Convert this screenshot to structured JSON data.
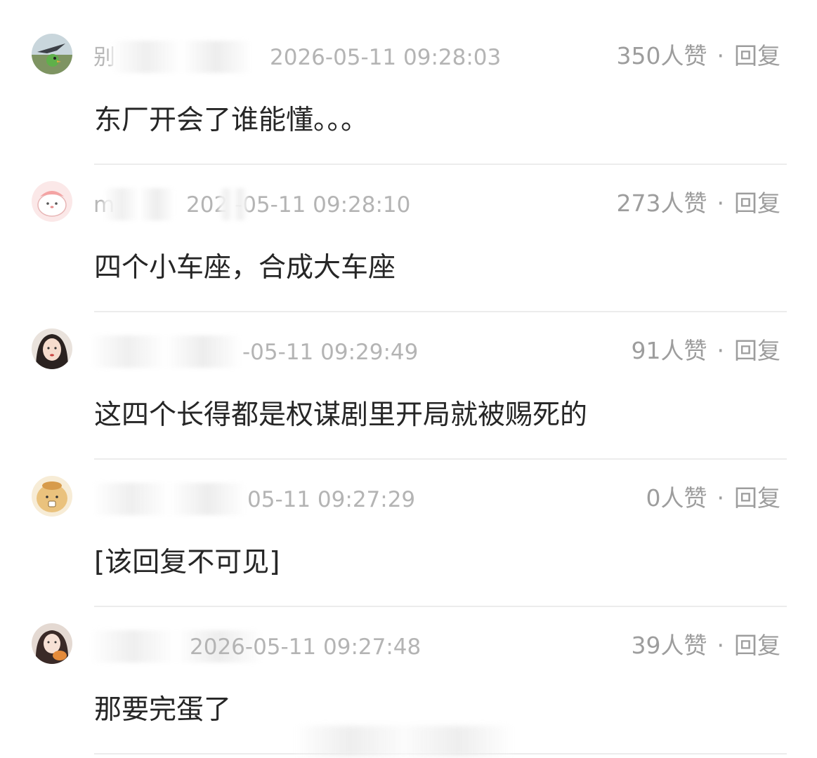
{
  "comments": [
    {
      "username_visible": "别",
      "timestamp": "2026-05-11 09:28:03",
      "likes": "350人赞",
      "separator": "·",
      "reply_label": "回复",
      "text": "东厂开会了谁能懂。。。",
      "avatar_icon": "bird-avatar-icon"
    },
    {
      "username_visible": "m",
      "timestamp": "202 -05-11 09:28:10",
      "likes": "273人赞",
      "separator": "·",
      "reply_label": "回复",
      "text": "四个小车座，合成大车座",
      "avatar_icon": "cartoon-pink-avatar-icon"
    },
    {
      "username_visible": "",
      "timestamp": "-05-11 09:29:49",
      "likes": "91人赞",
      "separator": "·",
      "reply_label": "回复",
      "text": "这四个长得都是权谋剧里开局就被赐死的",
      "avatar_icon": "girl-photo-avatar-icon"
    },
    {
      "username_visible": "",
      "timestamp": "05-11 09:27:29",
      "likes": "0人赞",
      "separator": "·",
      "reply_label": "回复",
      "text": "[该回复不可见]",
      "avatar_icon": "cartoon-bear-avatar-icon"
    },
    {
      "username_visible": "",
      "timestamp": "2026-05-11 09:27:48",
      "likes": "39人赞",
      "separator": "·",
      "reply_label": "回复",
      "text": "那要完蛋了",
      "avatar_icon": "girl-photo-avatar-icon"
    }
  ],
  "colors": {
    "content_text": "#262626",
    "meta_text": "#b4b4b4",
    "action_text": "#9d9d9d",
    "divider": "#ececec"
  }
}
